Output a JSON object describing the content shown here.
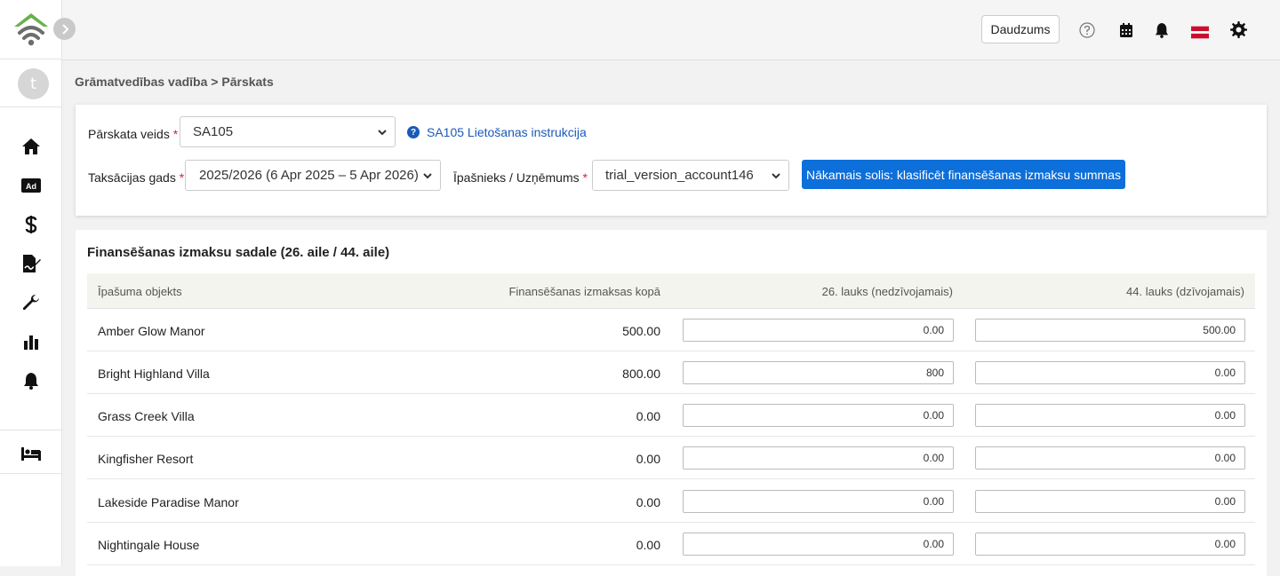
{
  "topbar": {
    "qty_button": "Daudzums"
  },
  "sidebar": {
    "avatar_letter": "t"
  },
  "breadcrumb": {
    "parent": "Grāmatvedības vadība",
    "separator": ">",
    "current": "Pārskats"
  },
  "filters": {
    "report_type_label": "Pārskata veids",
    "report_type_value": "SA105",
    "help_link": "SA105 Lietošanas instrukcija",
    "tax_year_label": "Taksācijas gads",
    "tax_year_value": "2025/2026 (6 Apr 2025 – 5 Apr 2026)",
    "owner_label": "Īpašnieks / Uzņēmums",
    "owner_value": "trial_version_account146",
    "required_mark": "*",
    "next_button": "Nākamais solis: klasificēt finansēšanas izmaksu summas"
  },
  "table": {
    "title": "Finansēšanas izmaksu sadale (26. aile / 44. aile)",
    "columns": {
      "property": "Īpašuma objekts",
      "total": "Finansēšanas izmaksas kopā",
      "box26": "26. lauks (nedzīvojamais)",
      "box44": "44. lauks (dzīvojamais)"
    },
    "rows": [
      {
        "name": "Amber Glow Manor",
        "total": "500.00",
        "box26": "0.00",
        "box44": "500.00"
      },
      {
        "name": "Bright Highland Villa",
        "total": "800.00",
        "box26": "800",
        "box44": "0.00"
      },
      {
        "name": "Grass Creek Villa",
        "total": "0.00",
        "box26": "0.00",
        "box44": "0.00"
      },
      {
        "name": "Kingfisher Resort",
        "total": "0.00",
        "box26": "0.00",
        "box44": "0.00"
      },
      {
        "name": "Lakeside Paradise Manor",
        "total": "0.00",
        "box26": "0.00",
        "box44": "0.00"
      },
      {
        "name": "Nightingale House",
        "total": "0.00",
        "box26": "0.00",
        "box44": "0.00"
      }
    ]
  },
  "icons": {
    "logo": "house-wifi-logo",
    "collapse": "chevron-right-icon",
    "nav": [
      "home-icon",
      "ad-icon",
      "dollar-icon",
      "file-signature-icon",
      "wrench-icon",
      "chart-bar-icon",
      "bell-icon",
      "bed-icon"
    ],
    "topbar": [
      "question-icon",
      "calendar-icon",
      "bell-icon",
      "flag-icon",
      "gear-icon"
    ]
  },
  "colors": {
    "accent": "#0d6fd9",
    "link": "#1a5ab8",
    "required": "#d9232d",
    "logo_green": "#6ab04c",
    "flag_red": "#c8102e"
  }
}
